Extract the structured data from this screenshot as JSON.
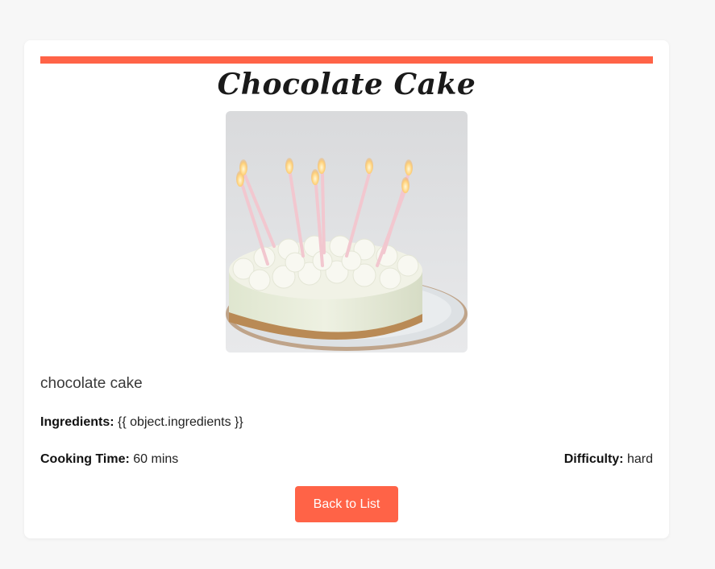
{
  "recipe": {
    "title": "Chocolate Cake",
    "image": "cake-with-candles-photo",
    "description": "chocolate cake",
    "ingredients_label": "Ingredients:",
    "ingredients_value": "{{ object.ingredients }}",
    "cooking_time_label": "Cooking Time:",
    "cooking_time_value": "60 mins",
    "difficulty_label": "Difficulty:",
    "difficulty_value": "hard"
  },
  "actions": {
    "back_label": "Back to List"
  },
  "colors": {
    "accent": "#ff6347",
    "page_background": "#f7f7f7",
    "card_background": "#ffffff",
    "text": "#222222"
  }
}
